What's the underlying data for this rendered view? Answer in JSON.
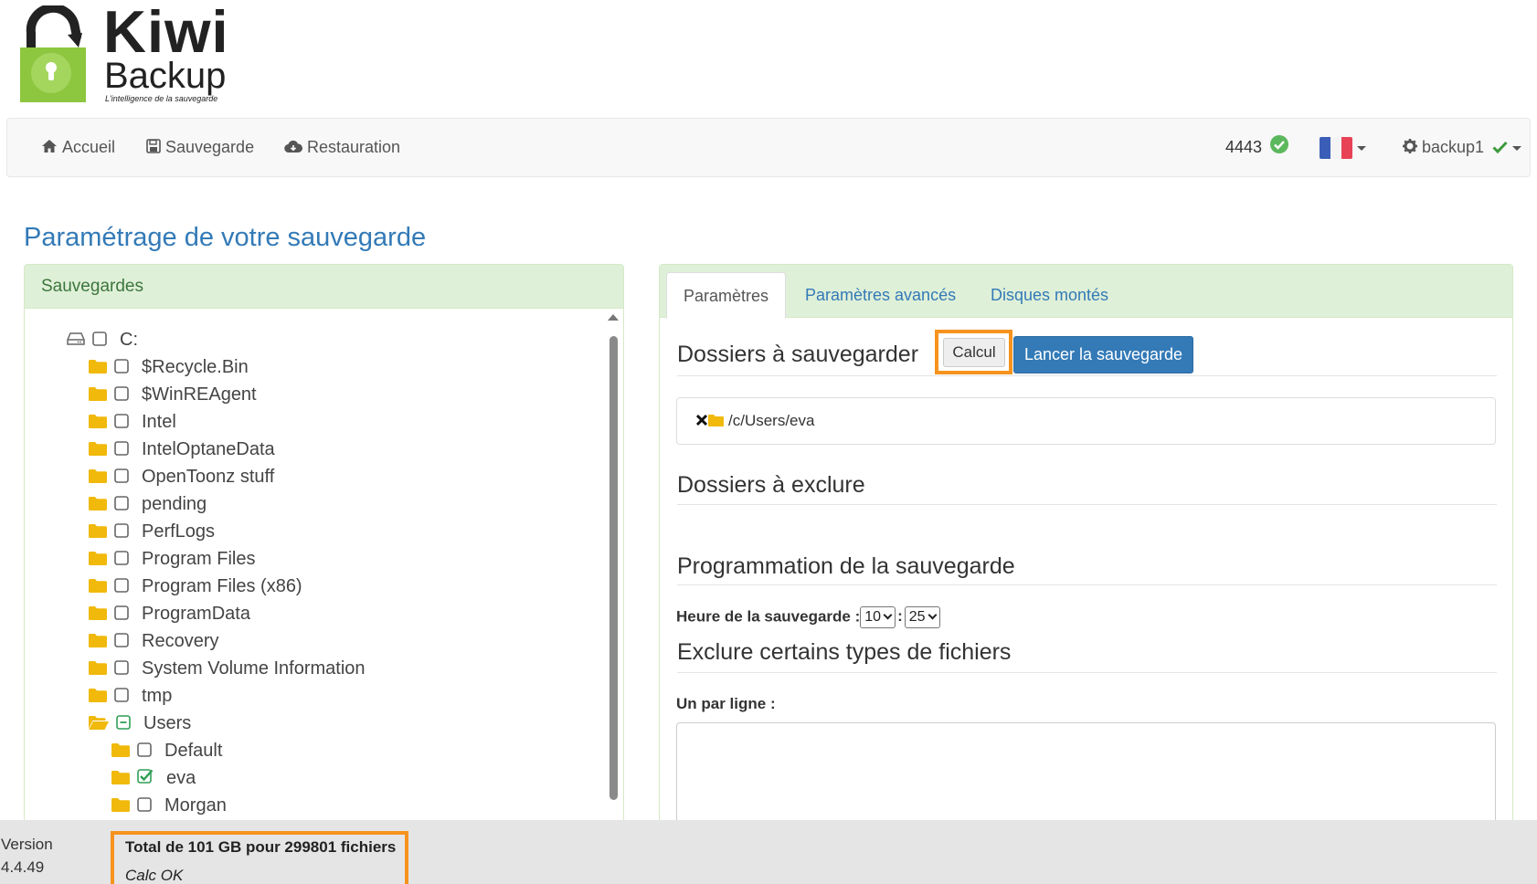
{
  "logo": {
    "name_line1": "Kiwi",
    "name_line2": "Backup",
    "tagline": "L'intelligence de la sauvegarde",
    "brand_color": "#8dc63f"
  },
  "navbar": {
    "items": [
      {
        "label": "Accueil",
        "icon": "home-icon"
      },
      {
        "label": "Sauvegarde",
        "icon": "save-icon"
      },
      {
        "label": "Restauration",
        "icon": "cloud-download-icon"
      }
    ],
    "counter": "4443",
    "counter_status_icon": "check-circle-icon",
    "language_flag": "fr",
    "user": "backup1",
    "user_status_icon": "check-icon"
  },
  "page": {
    "title": "Paramétrage de votre sauvegarde"
  },
  "left_panel": {
    "heading": "Sauvegardes",
    "drive": "C:",
    "folders": [
      {
        "label": "$Recycle.Bin",
        "checked": false
      },
      {
        "label": "$WinREAgent",
        "checked": false
      },
      {
        "label": "Intel",
        "checked": false
      },
      {
        "label": "IntelOptaneData",
        "checked": false
      },
      {
        "label": "OpenToonz stuff",
        "checked": false
      },
      {
        "label": "pending",
        "checked": false
      },
      {
        "label": "PerfLogs",
        "checked": false
      },
      {
        "label": "Program Files",
        "checked": false
      },
      {
        "label": "Program Files (x86)",
        "checked": false
      },
      {
        "label": "ProgramData",
        "checked": false
      },
      {
        "label": "Recovery",
        "checked": false
      },
      {
        "label": "System Volume Information",
        "checked": false
      },
      {
        "label": "tmp",
        "checked": false
      }
    ],
    "users_folder": {
      "label": "Users",
      "state": "partial",
      "expanded": true
    },
    "user_children": [
      {
        "label": "Default",
        "checked": false
      },
      {
        "label": "eva",
        "checked": true
      },
      {
        "label": "Morgan",
        "checked": false
      }
    ]
  },
  "right_panel": {
    "tabs": [
      {
        "label": "Paramètres",
        "active": true
      },
      {
        "label": "Paramètres avancés",
        "active": false
      },
      {
        "label": "Disques montés",
        "active": false
      }
    ],
    "folders_to_backup_heading": "Dossiers à sauvegarder",
    "calc_button": "Calcul",
    "start_button": "Lancer la sauvegarde",
    "selected_folders": [
      "/c/Users/eva"
    ],
    "folders_to_exclude_heading": "Dossiers à exclure",
    "schedule_heading": "Programmation de la sauvegarde",
    "time_label": "Heure de la sauvegarde :",
    "hour_value": "10",
    "time_separator": ":",
    "minute_value": "25",
    "exclude_types_heading": "Exclure certains types de fichiers",
    "one_per_line_label": "Un par ligne :",
    "exclude_types_value": ""
  },
  "footer": {
    "version_label": "Version",
    "version_number": "4.4.49",
    "total_text": "Total de 101 GB pour 299801 fichiers",
    "calc_status": "Calc OK",
    "highlight_color": "#f7931e"
  }
}
